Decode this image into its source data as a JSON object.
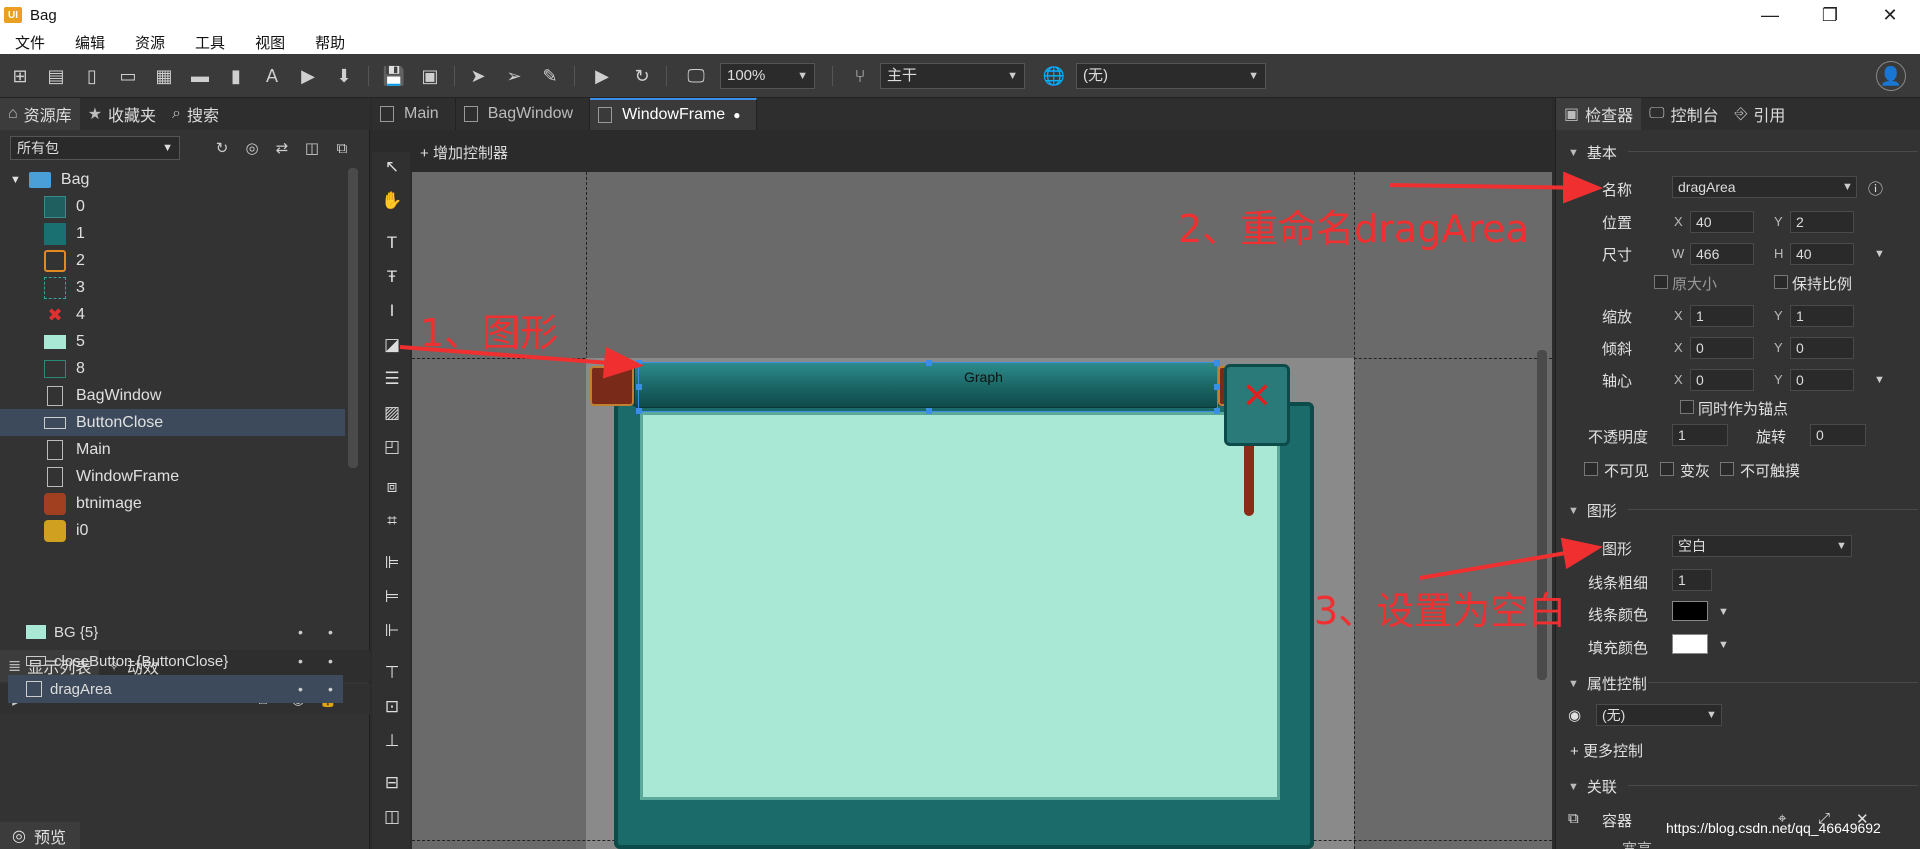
{
  "window": {
    "title": "Bag",
    "logo": "UI",
    "minimize": "—",
    "maximize": "❐",
    "close": "✕"
  },
  "menu": [
    "文件",
    "编辑",
    "资源",
    "工具",
    "视图",
    "帮助"
  ],
  "toolbar": {
    "zoom": "100%",
    "branch": "主干",
    "language": "(无)"
  },
  "left_panel": {
    "tabs": [
      "资源库",
      "收藏夹",
      "搜索"
    ],
    "package_filter": "所有包",
    "tree": [
      {
        "label": "Bag",
        "kind": "folder"
      },
      {
        "label": "0",
        "kind": "image"
      },
      {
        "label": "1",
        "kind": "image"
      },
      {
        "label": "2",
        "kind": "image"
      },
      {
        "label": "3",
        "kind": "image"
      },
      {
        "label": "4",
        "kind": "image"
      },
      {
        "label": "5",
        "kind": "image"
      },
      {
        "label": "8",
        "kind": "image"
      },
      {
        "label": "BagWindow",
        "kind": "component"
      },
      {
        "label": "ButtonClose",
        "kind": "button",
        "selected": true
      },
      {
        "label": "Main",
        "kind": "component"
      },
      {
        "label": "WindowFrame",
        "kind": "component"
      },
      {
        "label": "btnimage",
        "kind": "image"
      },
      {
        "label": "i0",
        "kind": "image"
      }
    ],
    "display_tabs": [
      "显示列表",
      "动效"
    ],
    "display_list": [
      {
        "label": "BG {5}"
      },
      {
        "label": "closeButton {ButtonClose}"
      },
      {
        "label": "dragArea",
        "selected": true
      }
    ],
    "preview": "预览"
  },
  "editor": {
    "tabs": [
      {
        "label": "Main"
      },
      {
        "label": "BagWindow"
      },
      {
        "label": "WindowFrame",
        "active": true,
        "modified": "●"
      }
    ],
    "add_controller": "增加控制器",
    "graph_label": "Graph",
    "close_glyph": "✕"
  },
  "inspector": {
    "tabs": [
      "检查器",
      "控制台",
      "引用"
    ],
    "basic": {
      "section": "基本",
      "name_label": "名称",
      "name_value": "dragArea",
      "position_label": "位置",
      "x": "40",
      "y": "2",
      "size_label": "尺寸",
      "w": "466",
      "h": "40",
      "original_size": "原大小",
      "keep_ratio": "保持比例",
      "scale_label": "缩放",
      "scale_x": "1",
      "scale_y": "1",
      "skew_label": "倾斜",
      "skew_x": "0",
      "skew_y": "0",
      "pivot_label": "轴心",
      "pivot_x": "0",
      "pivot_y": "0",
      "as_anchor": "同时作为锚点",
      "opacity_label": "不透明度",
      "opacity": "1",
      "rotation_label": "旋转",
      "rotation": "0",
      "invisible": "不可见",
      "grayed": "变灰",
      "untouchable": "不可触摸"
    },
    "graph": {
      "section": "图形",
      "type_label": "图形",
      "type_value": "空白",
      "line_width_label": "线条粗细",
      "line_width": "1",
      "line_color_label": "线条颜色",
      "line_color": "#000000",
      "fill_color_label": "填充颜色",
      "fill_color": "#ffffff"
    },
    "prop_control": {
      "section": "属性控制",
      "value": "(无)",
      "more": "更多控制"
    },
    "relation": {
      "section": "关联",
      "container": "容器",
      "partial": "宽高..."
    }
  },
  "annotations": {
    "step1": "1、图形",
    "step2": "2、重命名dragArea",
    "step3": "3、设置为空白"
  },
  "watermark": "https://blog.csdn.net/qq_46649692",
  "colors": {
    "accent": "#3a8ee6",
    "annotation": "#f03030",
    "panel_bg": "#333333",
    "canvas_bg": "#6a6a6a"
  }
}
